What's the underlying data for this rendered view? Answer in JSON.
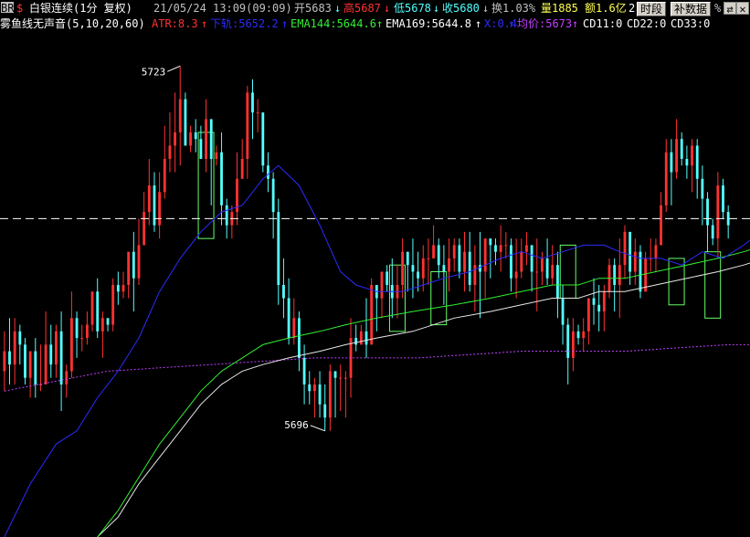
{
  "colors": {
    "bg": "#000000",
    "up": "#ff3232",
    "down": "#54ffff",
    "zone": "#66ff66",
    "ma_blue": "#2b2bff",
    "ma_green": "#33ee33",
    "ma_white": "#e6e6e6",
    "ma_magenta": "#c040ff",
    "dash": "#ffffff"
  },
  "header": {
    "badge": "BR",
    "marker": "$",
    "symbol": "白银连续(1分 复权)",
    "datetime": "21/05/24 13:09(09:09)",
    "open": "开5683",
    "high": "高5687",
    "low": "低5678",
    "close": "收5680",
    "turnover": "换1.03%",
    "volume": "量1885",
    "amount": "额1.6亿",
    "digit": "2",
    "btn_period": "时段",
    "btn_fill": "补数据",
    "tail": "%"
  },
  "indicator": {
    "name": "雾鱼线无声音(5,10,20,60)",
    "atr": "ATR:8.3",
    "lower": "下轨:5652.2",
    "ema144": "EMA144:5644.6",
    "ema169": "EMA169:5644.8",
    "x": "X:0.4",
    "avg": "均价:5673",
    "cd11": "CD11:0",
    "cd22": "CD22:0",
    "cd33": "CD33:0"
  },
  "annotations": {
    "max_label": "5723",
    "min_label": "5696"
  },
  "chart_data": {
    "type": "candlestick",
    "y_range": [
      5652,
      5728
    ],
    "dashed_level": 5700,
    "max_label": "5723",
    "min_label": "5696",
    "candles": [
      [
        5677,
        5680,
        5674,
        5683
      ],
      [
        5680,
        5678,
        5675,
        5685
      ],
      [
        5678,
        5683,
        5675,
        5685
      ],
      [
        5683,
        5681,
        5678,
        5684
      ],
      [
        5681,
        5676,
        5675,
        5682
      ],
      [
        5676,
        5680,
        5673,
        5680
      ],
      [
        5680,
        5675,
        5673,
        5682
      ],
      [
        5675,
        5675,
        5674,
        5681
      ],
      [
        5675,
        5681,
        5675,
        5686
      ],
      [
        5681,
        5678,
        5676,
        5684
      ],
      [
        5678,
        5683,
        5676,
        5684
      ],
      [
        5683,
        5675,
        5671,
        5686
      ],
      [
        5675,
        5677,
        5673,
        5678
      ],
      [
        5677,
        5685,
        5676,
        5689
      ],
      [
        5685,
        5682,
        5679,
        5686
      ],
      [
        5682,
        5682,
        5680,
        5684
      ],
      [
        5682,
        5684,
        5681,
        5686
      ],
      [
        5684,
        5689,
        5683,
        5689
      ],
      [
        5689,
        5683,
        5682,
        5691
      ],
      [
        5683,
        5685,
        5679,
        5686
      ],
      [
        5685,
        5684,
        5683,
        5685
      ],
      [
        5684,
        5690,
        5683,
        5691
      ],
      [
        5690,
        5689,
        5687,
        5692
      ],
      [
        5689,
        5690,
        5688,
        5692
      ],
      [
        5690,
        5695,
        5688,
        5695
      ],
      [
        5695,
        5691,
        5686,
        5698
      ],
      [
        5691,
        5696,
        5690,
        5700
      ],
      [
        5696,
        5701,
        5696,
        5704
      ],
      [
        5701,
        5705,
        5699,
        5709
      ],
      [
        5705,
        5699,
        5698,
        5707
      ],
      [
        5699,
        5704,
        5697,
        5707
      ],
      [
        5704,
        5709,
        5703,
        5714
      ],
      [
        5709,
        5711,
        5707,
        5716
      ],
      [
        5711,
        5713,
        5707,
        5719
      ],
      [
        5713,
        5718,
        5708,
        5723
      ],
      [
        5718,
        5711,
        5711,
        5719
      ],
      [
        5711,
        5713,
        5710,
        5714
      ],
      [
        5713,
        5712,
        5710,
        5715
      ],
      [
        5712,
        5709,
        5709,
        5714
      ],
      [
        5709,
        5715,
        5707,
        5718
      ],
      [
        5715,
        5709,
        5702,
        5715
      ],
      [
        5709,
        5710,
        5708,
        5711
      ],
      [
        5710,
        5702,
        5699,
        5713
      ],
      [
        5702,
        5699,
        5697,
        5703
      ],
      [
        5699,
        5701,
        5697,
        5702
      ],
      [
        5701,
        5706,
        5699,
        5710
      ],
      [
        5706,
        5709,
        5706,
        5712
      ],
      [
        5709,
        5719,
        5706,
        5720
      ],
      [
        5719,
        5716,
        5712,
        5721
      ],
      [
        5716,
        5716,
        5713,
        5718
      ],
      [
        5716,
        5708,
        5707,
        5716
      ],
      [
        5708,
        5706,
        5704,
        5710
      ],
      [
        5706,
        5701,
        5697,
        5707
      ],
      [
        5701,
        5690,
        5687,
        5703
      ],
      [
        5690,
        5688,
        5685,
        5694
      ],
      [
        5688,
        5682,
        5681,
        5691
      ],
      [
        5682,
        5685,
        5681,
        5688
      ],
      [
        5685,
        5679,
        5677,
        5686
      ],
      [
        5679,
        5675,
        5672,
        5681
      ],
      [
        5675,
        5674,
        5672,
        5677
      ],
      [
        5674,
        5675,
        5670,
        5676
      ],
      [
        5675,
        5672,
        5670,
        5677
      ],
      [
        5672,
        5670,
        5668,
        5675
      ],
      [
        5670,
        5677,
        5668,
        5678
      ],
      [
        5677,
        5676,
        5670,
        5677
      ],
      [
        5676,
        5676,
        5671,
        5678
      ],
      [
        5676,
        5676,
        5670,
        5677
      ],
      [
        5676,
        5682,
        5673,
        5685
      ],
      [
        5682,
        5681,
        5680,
        5684
      ],
      [
        5681,
        5683,
        5681,
        5684
      ],
      [
        5683,
        5681,
        5679,
        5688
      ],
      [
        5681,
        5690,
        5681,
        5691
      ],
      [
        5690,
        5688,
        5683,
        5690
      ],
      [
        5688,
        5692,
        5685,
        5692
      ],
      [
        5692,
        5690,
        5689,
        5693
      ],
      [
        5690,
        5688,
        5685,
        5694
      ],
      [
        5688,
        5690,
        5685,
        5693
      ],
      [
        5690,
        5695,
        5688,
        5697
      ],
      [
        5695,
        5693,
        5689,
        5695
      ],
      [
        5693,
        5692,
        5688,
        5697
      ],
      [
        5692,
        5691,
        5689,
        5695
      ],
      [
        5691,
        5694,
        5689,
        5696
      ],
      [
        5694,
        5694,
        5690,
        5697
      ],
      [
        5694,
        5696,
        5694,
        5699
      ],
      [
        5696,
        5693,
        5691,
        5697
      ],
      [
        5693,
        5692,
        5687,
        5696
      ],
      [
        5692,
        5694,
        5689,
        5697
      ],
      [
        5694,
        5696,
        5692,
        5697
      ],
      [
        5696,
        5692,
        5691,
        5697
      ],
      [
        5692,
        5695,
        5689,
        5698
      ],
      [
        5695,
        5690,
        5689,
        5698
      ],
      [
        5690,
        5693,
        5686,
        5696
      ],
      [
        5693,
        5692,
        5685,
        5698
      ],
      [
        5692,
        5697,
        5688,
        5697
      ],
      [
        5697,
        5696,
        5691,
        5697
      ],
      [
        5696,
        5695,
        5693,
        5697
      ],
      [
        5695,
        5696,
        5692,
        5699
      ],
      [
        5696,
        5696,
        5694,
        5698
      ],
      [
        5696,
        5691,
        5689,
        5697
      ],
      [
        5691,
        5692,
        5688,
        5697
      ],
      [
        5692,
        5695,
        5691,
        5697
      ],
      [
        5695,
        5696,
        5693,
        5698
      ],
      [
        5696,
        5692,
        5689,
        5696
      ],
      [
        5692,
        5692,
        5686,
        5697
      ],
      [
        5692,
        5694,
        5690,
        5695
      ],
      [
        5694,
        5691,
        5690,
        5697
      ],
      [
        5691,
        5693,
        5690,
        5696
      ],
      [
        5693,
        5688,
        5685,
        5695
      ],
      [
        5688,
        5684,
        5681,
        5690
      ],
      [
        5684,
        5679,
        5675,
        5685
      ],
      [
        5679,
        5683,
        5677,
        5685
      ],
      [
        5683,
        5682,
        5681,
        5684
      ],
      [
        5682,
        5683,
        5680,
        5685
      ],
      [
        5683,
        5688,
        5681,
        5688
      ],
      [
        5688,
        5687,
        5684,
        5691
      ],
      [
        5687,
        5686,
        5683,
        5690
      ],
      [
        5686,
        5689,
        5683,
        5690
      ],
      [
        5689,
        5693,
        5688,
        5694
      ],
      [
        5693,
        5690,
        5686,
        5694
      ],
      [
        5690,
        5693,
        5685,
        5697
      ],
      [
        5693,
        5698,
        5691,
        5699
      ],
      [
        5698,
        5692,
        5690,
        5698
      ],
      [
        5692,
        5695,
        5690,
        5697
      ],
      [
        5695,
        5689,
        5688,
        5696
      ],
      [
        5689,
        5694,
        5689,
        5695
      ],
      [
        5694,
        5694,
        5692,
        5697
      ],
      [
        5694,
        5696,
        5692,
        5697
      ],
      [
        5696,
        5702,
        5696,
        5704
      ],
      [
        5702,
        5710,
        5701,
        5712
      ],
      [
        5710,
        5707,
        5702,
        5712
      ],
      [
        5707,
        5712,
        5706,
        5715
      ],
      [
        5712,
        5709,
        5708,
        5713
      ],
      [
        5709,
        5708,
        5706,
        5711
      ],
      [
        5708,
        5711,
        5704,
        5712
      ],
      [
        5711,
        5706,
        5703,
        5712
      ],
      [
        5706,
        5703,
        5699,
        5708
      ],
      [
        5703,
        5699,
        5695,
        5704
      ],
      [
        5699,
        5697,
        5696,
        5700
      ],
      [
        5697,
        5705,
        5694,
        5707
      ],
      [
        5705,
        5701,
        5700,
        5706
      ],
      [
        5701,
        5699,
        5697,
        5702
      ]
    ],
    "zones": [
      [
        38,
        40,
        5697,
        5713
      ],
      [
        75,
        77,
        5683,
        5693
      ],
      [
        83,
        85,
        5684,
        5692
      ],
      [
        108,
        110,
        5688,
        5696
      ],
      [
        129,
        131,
        5687,
        5694
      ],
      [
        136,
        138,
        5685,
        5695
      ],
      [
        154,
        155,
        5698,
        5706
      ],
      [
        159,
        161,
        5697,
        5704
      ]
    ],
    "ma_blue": [
      [
        0,
        5652
      ],
      [
        5,
        5660
      ],
      [
        10,
        5666
      ],
      [
        14,
        5668
      ],
      [
        18,
        5673
      ],
      [
        22,
        5677
      ],
      [
        26,
        5682
      ],
      [
        30,
        5689
      ],
      [
        34,
        5694
      ],
      [
        38,
        5698
      ],
      [
        42,
        5701
      ],
      [
        46,
        5702
      ],
      [
        50,
        5706
      ],
      [
        53,
        5708
      ],
      [
        57,
        5705
      ],
      [
        61,
        5699
      ],
      [
        65,
        5692
      ],
      [
        68,
        5690
      ],
      [
        72,
        5689
      ],
      [
        77,
        5689
      ],
      [
        81,
        5690
      ],
      [
        85,
        5691
      ],
      [
        90,
        5692
      ],
      [
        96,
        5694
      ],
      [
        100,
        5695
      ],
      [
        104,
        5694
      ],
      [
        108,
        5695
      ],
      [
        112,
        5696
      ],
      [
        116,
        5696
      ],
      [
        119,
        5695
      ],
      [
        123,
        5694
      ],
      [
        127,
        5694
      ],
      [
        131,
        5693
      ],
      [
        135,
        5695
      ],
      [
        139,
        5694
      ],
      [
        143,
        5696
      ],
      [
        148,
        5699
      ],
      [
        152,
        5700
      ],
      [
        155,
        5701
      ]
    ],
    "ma_green": [
      [
        18,
        5652
      ],
      [
        22,
        5656
      ],
      [
        26,
        5661
      ],
      [
        30,
        5666
      ],
      [
        34,
        5670
      ],
      [
        38,
        5674
      ],
      [
        42,
        5677
      ],
      [
        46,
        5679
      ],
      [
        50,
        5681
      ],
      [
        55,
        5682
      ],
      [
        61,
        5683
      ],
      [
        66,
        5684
      ],
      [
        72,
        5685
      ],
      [
        79,
        5686
      ],
      [
        87,
        5687
      ],
      [
        94,
        5688
      ],
      [
        100,
        5689
      ],
      [
        106,
        5690
      ],
      [
        111,
        5690
      ],
      [
        115,
        5691
      ],
      [
        120,
        5691
      ],
      [
        126,
        5692
      ],
      [
        132,
        5693
      ],
      [
        138,
        5694
      ],
      [
        143,
        5695
      ],
      [
        147,
        5696
      ],
      [
        152,
        5696
      ],
      [
        157,
        5697
      ]
    ],
    "ma_white": [
      [
        18,
        5652
      ],
      [
        22,
        5655
      ],
      [
        26,
        5660
      ],
      [
        30,
        5664
      ],
      [
        34,
        5668
      ],
      [
        38,
        5672
      ],
      [
        42,
        5675
      ],
      [
        46,
        5677
      ],
      [
        50,
        5678
      ],
      [
        55,
        5679
      ],
      [
        61,
        5680
      ],
      [
        66,
        5681
      ],
      [
        72,
        5682
      ],
      [
        79,
        5683
      ],
      [
        87,
        5685
      ],
      [
        94,
        5686
      ],
      [
        100,
        5687
      ],
      [
        106,
        5688
      ],
      [
        111,
        5688
      ],
      [
        115,
        5689
      ],
      [
        120,
        5689
      ],
      [
        126,
        5690
      ],
      [
        132,
        5691
      ],
      [
        138,
        5692
      ],
      [
        143,
        5693
      ],
      [
        147,
        5694
      ],
      [
        152,
        5695
      ],
      [
        157,
        5695
      ]
    ],
    "ma_magenta": [
      [
        0,
        5674
      ],
      [
        20,
        5677
      ],
      [
        40,
        5678
      ],
      [
        60,
        5679
      ],
      [
        80,
        5679
      ],
      [
        100,
        5680
      ],
      [
        120,
        5680
      ],
      [
        140,
        5681
      ],
      [
        157,
        5681
      ]
    ]
  }
}
